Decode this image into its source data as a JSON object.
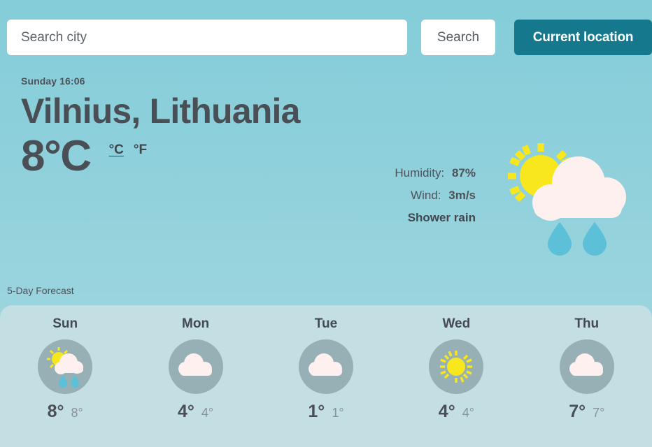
{
  "search": {
    "placeholder": "Search city",
    "value": "",
    "search_label": "Search",
    "location_label": "Current location"
  },
  "current": {
    "datetime": "Sunday 16:06",
    "city": "Vilnius, Lithuania",
    "temperature": "8°C",
    "unit_celsius": "°C",
    "unit_fahrenheit": "°F",
    "active_unit": "celsius",
    "humidity_label": "Humidity:",
    "humidity_value": "87%",
    "wind_label": "Wind:",
    "wind_value": "3m/s",
    "description": "Shower rain",
    "icon": "sun-cloud-rain-icon"
  },
  "forecast": {
    "title": "5-Day Forecast",
    "days": [
      {
        "day": "Sun",
        "icon": "sun-cloud-rain-icon",
        "max": "8°",
        "min": "8°"
      },
      {
        "day": "Mon",
        "icon": "cloud-icon",
        "max": "4°",
        "min": "4°"
      },
      {
        "day": "Tue",
        "icon": "cloud-icon",
        "max": "1°",
        "min": "1°"
      },
      {
        "day": "Wed",
        "icon": "sun-icon",
        "max": "4°",
        "min": "4°"
      },
      {
        "day": "Thu",
        "icon": "cloud-icon",
        "max": "7°",
        "min": "7°"
      }
    ]
  },
  "colors": {
    "background_top": "#84cdd9",
    "background_bottom": "#a6d8e0",
    "panel": "#c3dfe4",
    "accent_button": "#15788c",
    "icon_circle": "#97b0b5",
    "sun": "#f8e71c",
    "cloud": "#fdf0ee",
    "raindrop": "#5bc0d8",
    "text": "#4a4f56",
    "text_muted": "#8b9298"
  }
}
